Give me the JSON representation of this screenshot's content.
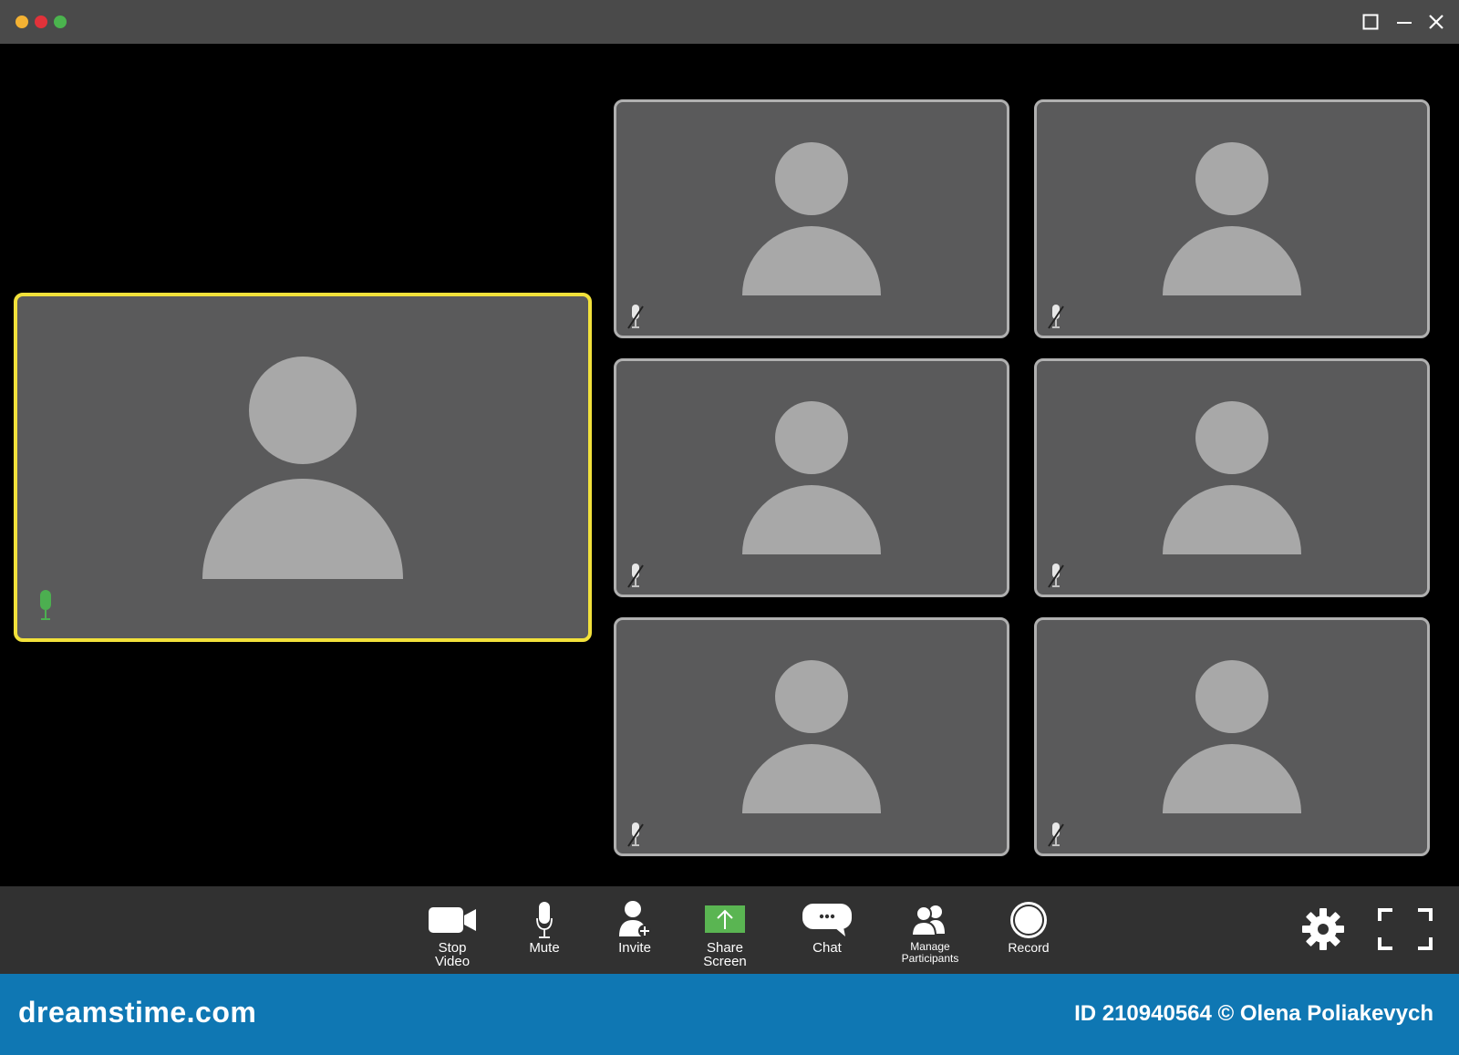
{
  "toolbar": {
    "stop_video": "Stop\nVideo",
    "mute": "Mute",
    "invite": "Invite",
    "share_screen": "Share\nScreen",
    "chat": "Chat",
    "manage_participants": "Manage\nParticipants",
    "record": "Record"
  },
  "footer": {
    "brand": "dreamstime.com",
    "credit": "ID 210940564 © Olena Poliakevych"
  },
  "colors": {
    "titlebar": "#4a4a4a",
    "tile_bg": "#5a5a5b",
    "tile_border": "#b0b0b0",
    "active_border": "#f2e13b",
    "avatar": "#a8a8a8",
    "mic_on": "#4caf50",
    "share_green": "#5ab552",
    "footer": "#0f77b3",
    "toolbar": "#313131"
  },
  "icons": {
    "active_speaker_mic": "microphone-icon",
    "participant_mic": "muted-microphone-icon"
  }
}
